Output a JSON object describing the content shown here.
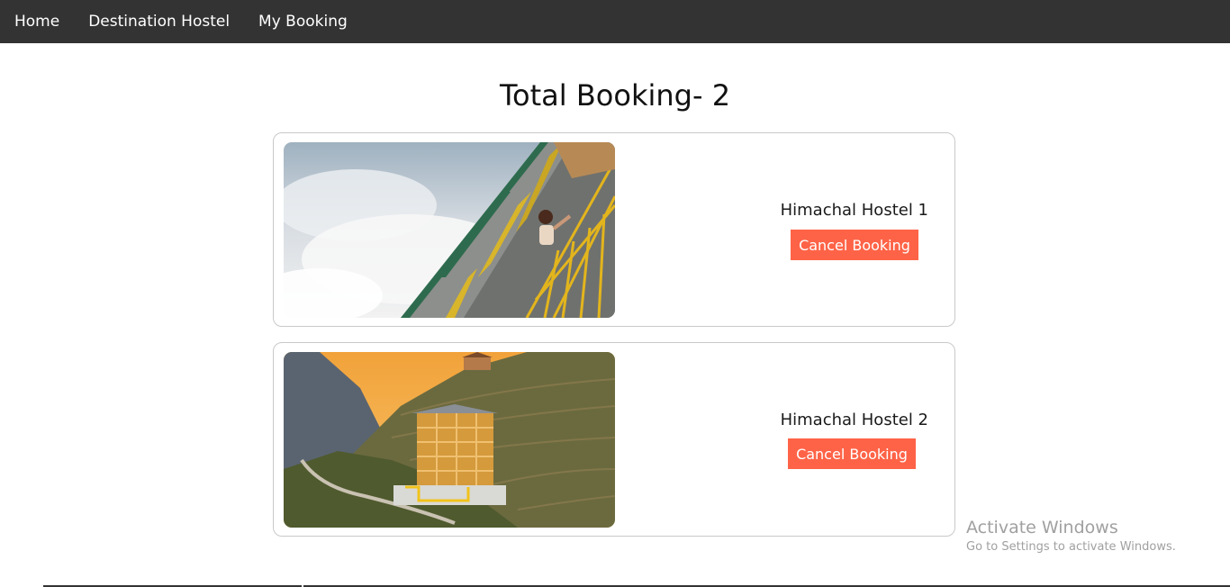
{
  "nav": {
    "items": [
      {
        "label": "Home"
      },
      {
        "label": "Destination Hostel"
      },
      {
        "label": "My Booking"
      }
    ]
  },
  "main": {
    "title": "Total Booking- 2",
    "bookings": [
      {
        "name": "Himachal Hostel 1",
        "button_label": "Cancel Booking"
      },
      {
        "name": "Himachal Hostel 2",
        "button_label": "Cancel Booking"
      }
    ]
  },
  "watermark": {
    "title": "Activate Windows",
    "subtitle": "Go to Settings to activate Windows."
  },
  "colors": {
    "navbar": "#333333",
    "button": "#ff6347",
    "card_border": "#c9c9c9"
  }
}
